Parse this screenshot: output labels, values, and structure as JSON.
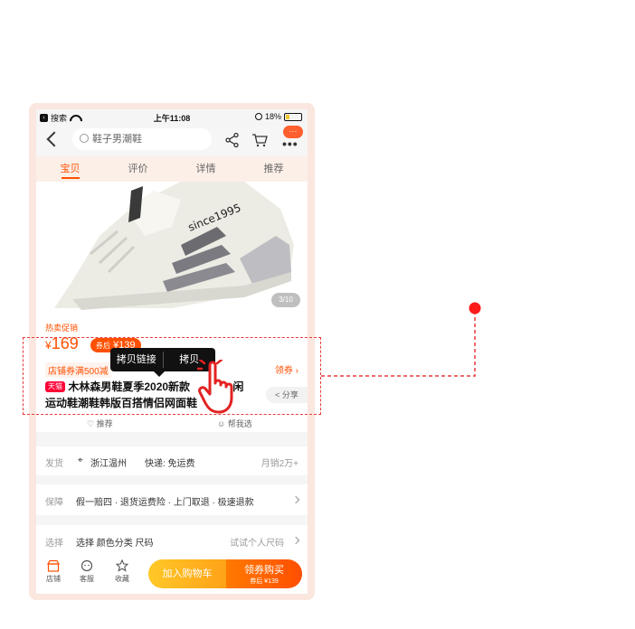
{
  "status_bar": {
    "back_app": "搜索",
    "time": "上午11:08",
    "battery": "18%"
  },
  "nav": {
    "search_placeholder": "鞋子男潮鞋",
    "more_badge": "···"
  },
  "tabs": [
    {
      "label": "宝贝",
      "active": true
    },
    {
      "label": "评价"
    },
    {
      "label": "详情"
    },
    {
      "label": "推荐"
    }
  ],
  "product": {
    "image_counter": "3/10",
    "hot_label": "热卖促销",
    "price_symbol": "¥",
    "price": "169",
    "coupon_prefix": "券后",
    "coupon_price": "¥139",
    "store_coupon": "店铺券满500减",
    "get_coupon": "领券 ›",
    "badge": "天猫",
    "title_line1": "木林森男鞋夏季2020新款",
    "title_tail1": "闲",
    "title_line2": "运动鞋潮鞋韩版百搭情侣网面鞋",
    "share": "分享",
    "favorite": "推荐",
    "help_select": "帮我选"
  },
  "copy_popup": {
    "copy_link": "拷贝链接",
    "copy": "拷贝"
  },
  "rows": {
    "ship_label": "发货",
    "ship_from": "浙江温州",
    "ship_fee": "快递: 免运费",
    "monthly_sales": "月销2万+",
    "guarantee_label": "保障",
    "guarantee_text": "假一赔四 · 退货运费险 · 上门取退 · 极速退款",
    "select_label": "选择",
    "select_text": "选择 颜色分类 尺码",
    "try_on": "试试个人尺码"
  },
  "bottom_bar": {
    "store": "店铺",
    "service": "客服",
    "favorite": "收藏",
    "add_cart": "加入购物车",
    "buy_main": "领券购买",
    "buy_sub": "券后 ¥139"
  },
  "colors": {
    "accent": "#ff5000",
    "annotation": "#e53a3a"
  }
}
